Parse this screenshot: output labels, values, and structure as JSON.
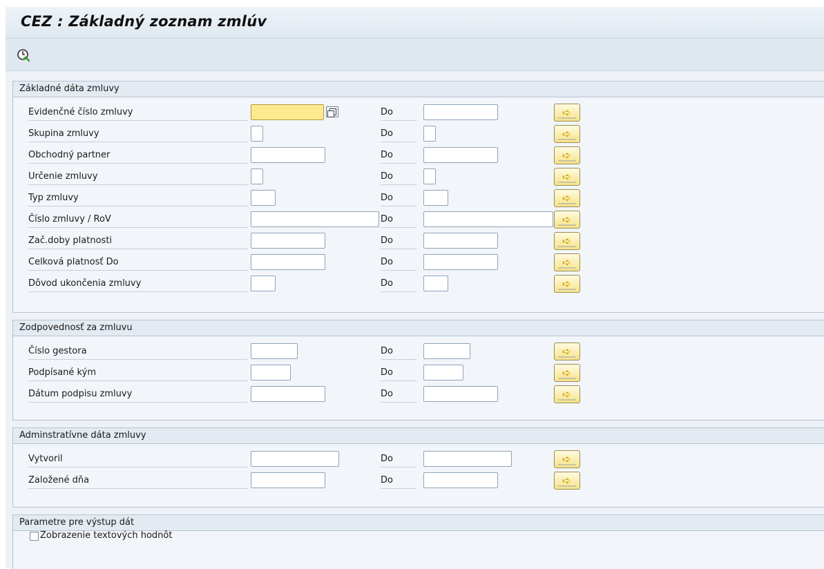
{
  "window": {
    "title": "CEZ : Základný zoznam zmlúv"
  },
  "toolbar": {
    "execute_icon": "execute-clock-icon"
  },
  "groups": {
    "basic": {
      "title": "Základné dáta zmluvy",
      "rows": [
        {
          "label": "Evidenčné číslo zmluvy",
          "to": "Do"
        },
        {
          "label": "Skupina zmluvy",
          "to": "Do"
        },
        {
          "label": "Obchodný partner",
          "to": "Do"
        },
        {
          "label": "Určenie zmluvy",
          "to": "Do"
        },
        {
          "label": "Typ zmluvy",
          "to": "Do"
        },
        {
          "label": "Číslo zmluvy / RoV",
          "to": "Do"
        },
        {
          "label": "Zač.doby platnosti",
          "to": "Do"
        },
        {
          "label": "Celková platnosť Do",
          "to": "Do"
        },
        {
          "label": "Dôvod ukončenia zmluvy",
          "to": "Do"
        }
      ]
    },
    "responsibility": {
      "title": "Zodpovednosť za zmluvu",
      "rows": [
        {
          "label": "Číslo gestora",
          "to": "Do"
        },
        {
          "label": "Podpísané kým",
          "to": "Do"
        },
        {
          "label": "Dátum podpisu zmluvy",
          "to": "Do"
        }
      ]
    },
    "admin": {
      "title": "Adminstratívne dáta zmluvy",
      "rows": [
        {
          "label": "Vytvoril",
          "to": "Do"
        },
        {
          "label": "Založené dňa",
          "to": "Do"
        }
      ]
    },
    "output": {
      "title": "Parametre pre výstup dát",
      "checkbox_label": "Zobrazenie textových hodnôt",
      "checkbox_checked": false
    }
  },
  "colors": {
    "focus_field": "#fde98f",
    "multisel_button": "#f6e38a"
  }
}
